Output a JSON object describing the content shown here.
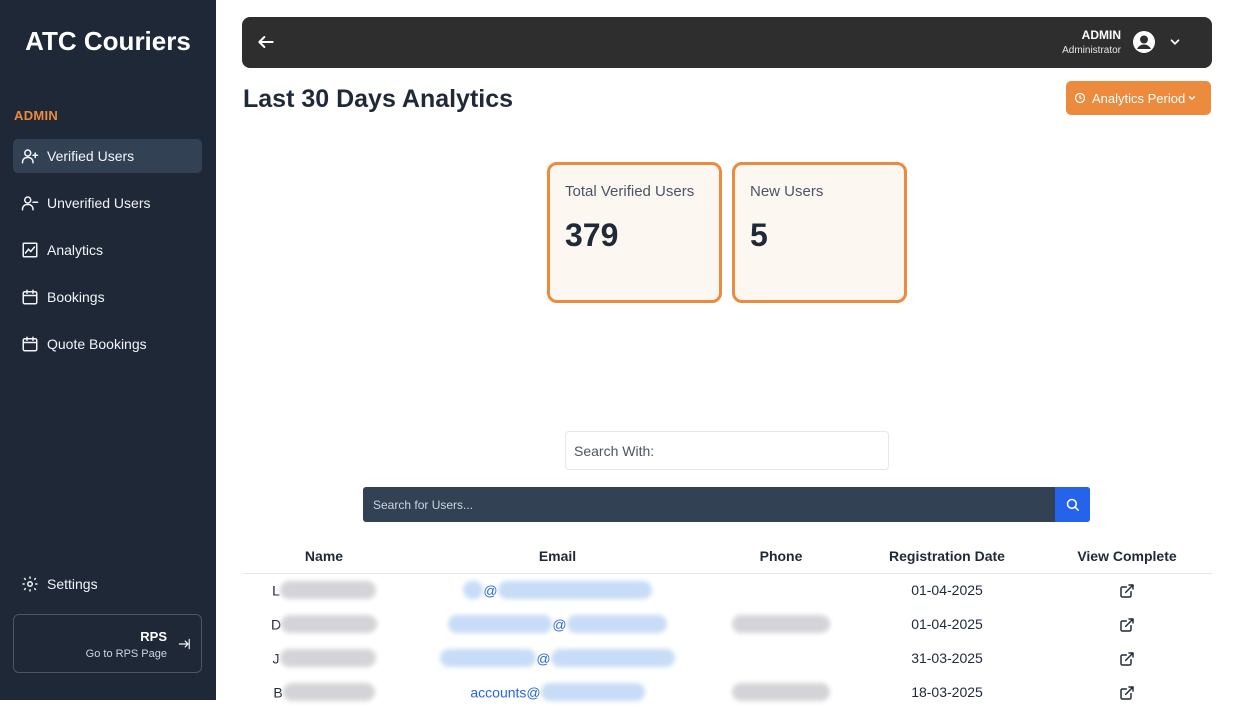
{
  "sidebar": {
    "brand": "ATC Couriers",
    "section_label": "ADMIN",
    "items": [
      {
        "label": "Verified Users",
        "icon": "user-plus-icon",
        "active": true
      },
      {
        "label": "Unverified Users",
        "icon": "user-minus-icon",
        "active": false
      },
      {
        "label": "Analytics",
        "icon": "chart-icon",
        "active": false
      },
      {
        "label": "Bookings",
        "icon": "calendar-icon",
        "active": false
      },
      {
        "label": "Quote Bookings",
        "icon": "calendar-icon",
        "active": false
      }
    ],
    "settings_label": "Settings",
    "rps": {
      "title": "RPS",
      "subtitle": "Go to RPS Page"
    }
  },
  "header": {
    "user_name": "ADMIN",
    "user_role": "Administrator"
  },
  "main": {
    "title": "Last 30 Days Analytics",
    "period_button": "Analytics Period",
    "cards": [
      {
        "label": "Total Verified Users",
        "value": "379"
      },
      {
        "label": "New Users",
        "value": "5"
      }
    ],
    "search_with_label": "Search With:",
    "search_placeholder": "Search for Users...",
    "table": {
      "headers": [
        "Name",
        "Email",
        "Phone",
        "Registration Date",
        "View Complete"
      ],
      "rows": [
        {
          "name_initial": "L",
          "email_visible": "@",
          "phone_visible": false,
          "date": "01-04-2025"
        },
        {
          "name_initial": "D",
          "email_visible": "@",
          "phone_visible": true,
          "date": "01-04-2025"
        },
        {
          "name_initial": "J",
          "email_visible": "@",
          "phone_visible": false,
          "date": "31-03-2025"
        },
        {
          "name_initial": "B",
          "email_visible": "accounts@",
          "phone_visible": true,
          "date": "18-03-2025"
        }
      ]
    }
  },
  "colors": {
    "sidebar_bg": "#1f2836",
    "accent": "#ec8a3e",
    "topbar_bg": "#2e2e2e",
    "search_bar_bg": "#334155",
    "search_button": "#2563eb"
  }
}
